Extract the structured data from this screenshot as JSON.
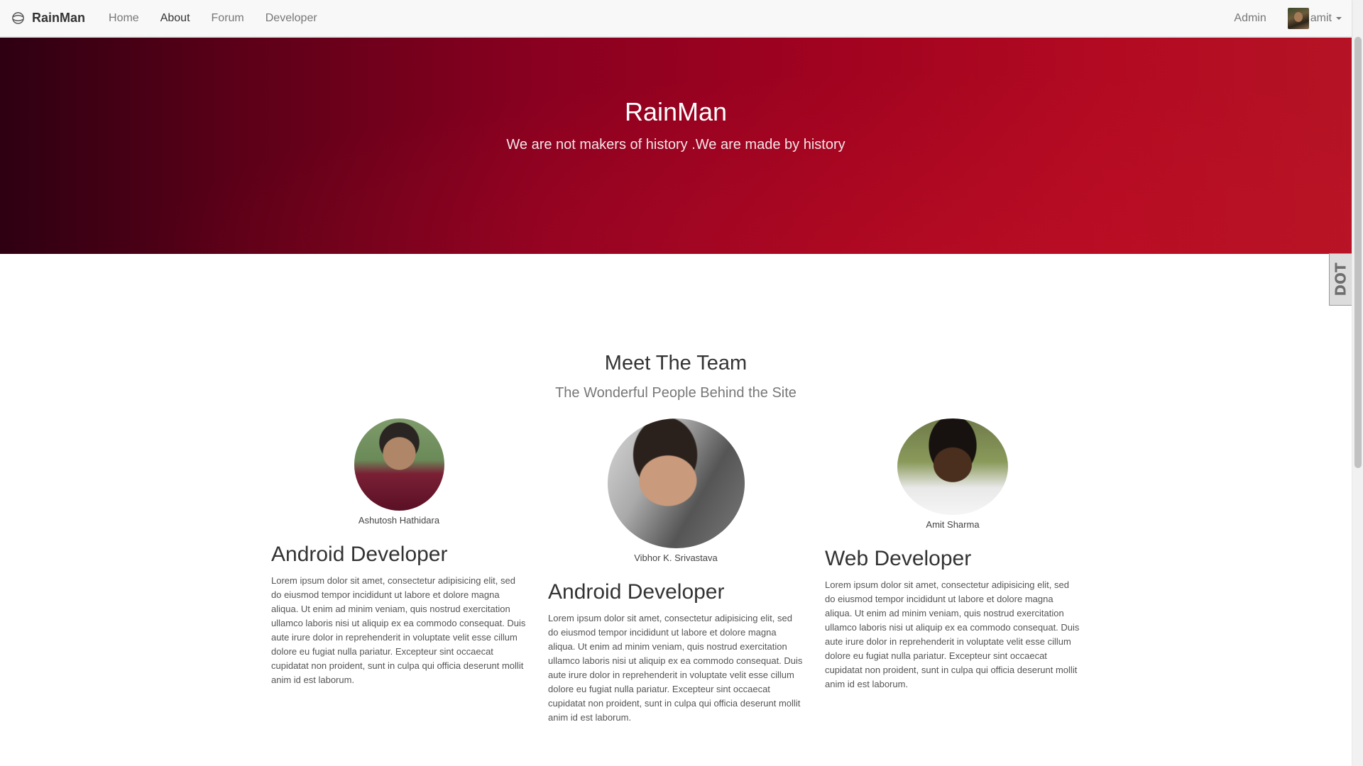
{
  "navbar": {
    "brand": "RainMan",
    "links": [
      {
        "label": "Home",
        "active": false
      },
      {
        "label": "About",
        "active": true
      },
      {
        "label": "Forum",
        "active": false
      },
      {
        "label": "Developer",
        "active": false
      }
    ],
    "admin_label": "Admin",
    "user_name": "amit"
  },
  "hero": {
    "title": "RainMan",
    "subtitle": "We are not makers of history .We are made by history"
  },
  "side_widget": {
    "label": "DOT"
  },
  "team": {
    "title": "Meet The Team",
    "subtitle": "The Wonderful People Behind the Site",
    "members": [
      {
        "name": "Ashutosh Hathidara",
        "role": "Android Developer",
        "bio": "Lorem ipsum dolor sit amet, consectetur adipisicing elit, sed do eiusmod tempor incididunt ut labore et dolore magna aliqua. Ut enim ad minim veniam, quis nostrud exercitation ullamco laboris nisi ut aliquip ex ea commodo consequat. Duis aute irure dolor in reprehenderit in voluptate velit esse cillum dolore eu fugiat nulla pariatur. Excepteur sint occaecat cupidatat non proident, sunt in culpa qui officia deserunt mollit anim id est laborum."
      },
      {
        "name": "Vibhor K. Srivastava",
        "role": "Android Developer",
        "bio": "Lorem ipsum dolor sit amet, consectetur adipisicing elit, sed do eiusmod tempor incididunt ut labore et dolore magna aliqua. Ut enim ad minim veniam, quis nostrud exercitation ullamco laboris nisi ut aliquip ex ea commodo consequat. Duis aute irure dolor in reprehenderit in voluptate velit esse cillum dolore eu fugiat nulla pariatur. Excepteur sint occaecat cupidatat non proident, sunt in culpa qui officia deserunt mollit anim id est laborum."
      },
      {
        "name": "Amit Sharma",
        "role": "Web Developer",
        "bio": "Lorem ipsum dolor sit amet, consectetur adipisicing elit, sed do eiusmod tempor incididunt ut labore et dolore magna aliqua. Ut enim ad minim veniam, quis nostrud exercitation ullamco laboris nisi ut aliquip ex ea commodo consequat. Duis aute irure dolor in reprehenderit in voluptate velit esse cillum dolore eu fugiat nulla pariatur. Excepteur sint occaecat cupidatat non proident, sunt in culpa qui officia deserunt mollit anim id est laborum."
      }
    ]
  }
}
